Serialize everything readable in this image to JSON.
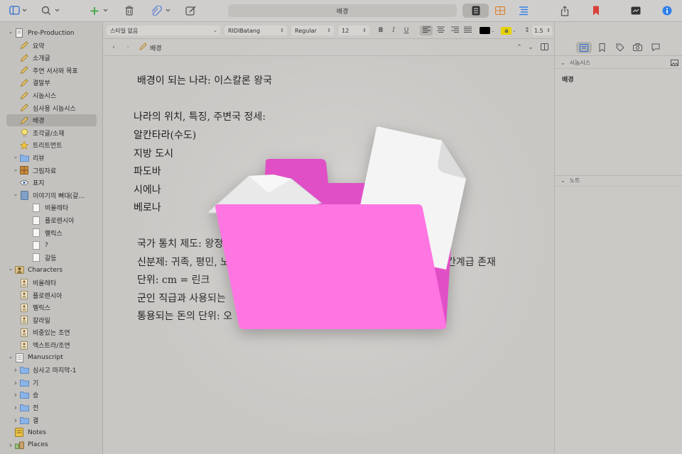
{
  "toolbar": {
    "title": "배경",
    "icons": [
      "sidebar-toggle-icon",
      "search-icon",
      "add-icon",
      "trash-icon",
      "attach-icon",
      "compose-icon",
      "outline-view-icon",
      "corkboard-view-icon",
      "scrivenings-view-icon",
      "share-icon",
      "bookmark-icon",
      "inspector-toggle-icon",
      "info-icon"
    ]
  },
  "binder": {
    "items": [
      {
        "label": "Pre-Production",
        "icon": "folder-document-icon",
        "disclosure": "open",
        "indent": 0
      },
      {
        "label": "요약",
        "icon": "pencil-icon",
        "disclosure": "",
        "indent": 1
      },
      {
        "label": "소개글",
        "icon": "pencil-icon",
        "disclosure": "",
        "indent": 1
      },
      {
        "label": "주연 서사와 목표",
        "icon": "pencil-icon",
        "disclosure": "",
        "indent": 1
      },
      {
        "label": "결말부",
        "icon": "pencil-icon",
        "disclosure": "",
        "indent": 1
      },
      {
        "label": "시놉시스",
        "icon": "pencil-icon",
        "disclosure": "",
        "indent": 1
      },
      {
        "label": "심사용 시놉시스",
        "icon": "pencil-icon",
        "disclosure": "",
        "indent": 1
      },
      {
        "label": "배경",
        "icon": "pencil-icon",
        "disclosure": "",
        "indent": 1,
        "selected": true
      },
      {
        "label": "조각글/소재",
        "icon": "lightbulb-icon",
        "disclosure": "",
        "indent": 1
      },
      {
        "label": "트리트먼트",
        "icon": "star-icon",
        "disclosure": "",
        "indent": 1
      },
      {
        "label": "리뷰",
        "icon": "folder-icon",
        "disclosure": "open",
        "indent": 1
      },
      {
        "label": "그림자료",
        "icon": "image-grid-icon",
        "disclosure": "open",
        "indent": 1
      },
      {
        "label": "표지",
        "icon": "eye-icon",
        "disclosure": "",
        "indent": 1
      },
      {
        "label": "이야기의 뼈대(갈…",
        "icon": "notebook-icon",
        "disclosure": "open",
        "indent": 1
      },
      {
        "label": "비올레타",
        "icon": "document-icon",
        "disclosure": "",
        "indent": 2
      },
      {
        "label": "플로렌시아",
        "icon": "document-icon",
        "disclosure": "",
        "indent": 2
      },
      {
        "label": "펠릭스",
        "icon": "document-icon",
        "disclosure": "",
        "indent": 2
      },
      {
        "label": "?",
        "icon": "document-icon",
        "disclosure": "",
        "indent": 2
      },
      {
        "label": "갈등",
        "icon": "document-icon",
        "disclosure": "",
        "indent": 2
      },
      {
        "label": "Characters",
        "icon": "character-folder-icon",
        "disclosure": "open",
        "indent": 0
      },
      {
        "label": "비올레타",
        "icon": "character-sheet-icon",
        "disclosure": "",
        "indent": 1
      },
      {
        "label": "플로렌시아",
        "icon": "character-sheet-icon",
        "disclosure": "",
        "indent": 1
      },
      {
        "label": "펠릭스",
        "icon": "character-sheet-icon",
        "disclosure": "",
        "indent": 1
      },
      {
        "label": "칼라일",
        "icon": "character-sheet-icon",
        "disclosure": "",
        "indent": 1
      },
      {
        "label": "비중있는 조연",
        "icon": "character-sheet-icon",
        "disclosure": "",
        "indent": 1
      },
      {
        "label": "엑스트라/조연",
        "icon": "character-sheet-icon",
        "disclosure": "",
        "indent": 1
      },
      {
        "label": "Manuscript",
        "icon": "manuscript-icon",
        "disclosure": "open",
        "indent": 0
      },
      {
        "label": "심사고 마지막-1",
        "icon": "folder-icon",
        "disclosure": "closed",
        "indent": 1
      },
      {
        "label": "기",
        "icon": "folder-icon",
        "disclosure": "closed",
        "indent": 1
      },
      {
        "label": "승",
        "icon": "folder-icon",
        "disclosure": "closed",
        "indent": 1
      },
      {
        "label": "전",
        "icon": "folder-icon",
        "disclosure": "closed",
        "indent": 1
      },
      {
        "label": "결",
        "icon": "folder-icon",
        "disclosure": "closed",
        "indent": 1
      },
      {
        "label": "Notes",
        "icon": "notes-icon",
        "disclosure": "",
        "indent": 0
      },
      {
        "label": "Places",
        "icon": "places-icon",
        "disclosure": "closed",
        "indent": 0
      }
    ]
  },
  "format": {
    "style": "스타일 없음",
    "font": "RIDIBatang",
    "weight": "Regular",
    "size": "12",
    "bold": "B",
    "italic": "I",
    "underline": "U",
    "highlight": "a",
    "line_spacing": "1.5",
    "text_color": "#000000",
    "highlight_color": "#e6d200"
  },
  "header": {
    "doc_title": "배경"
  },
  "editor": {
    "lines": [
      "배경이 되는 나라: 이스칼론 왕국",
      "나라의 위치, 특징, 주변국 정세:",
      "알칸타라(수도)",
      "지방 도시",
      "파도바",
      "시에나",
      "베로나",
      "국가 통치 제도: 왕정",
      "신분제: 귀족, 평민, 노",
      "단위: cm = 린크",
      "군인 직급과 사용되는",
      "통용되는 돈의 단위: 오",
      "간계급 존재"
    ]
  },
  "inspector": {
    "synopsis_header": "시놉시스",
    "synopsis_title": "배경",
    "notes_header": "노트"
  },
  "colors": {
    "folder_front": "#ff74e2",
    "folder_back": "#e04fc6",
    "paper": "#f4f4f4",
    "info_blue": "#2f7fea",
    "bookmark_red": "#d8403a",
    "add_green": "#3fa646"
  }
}
